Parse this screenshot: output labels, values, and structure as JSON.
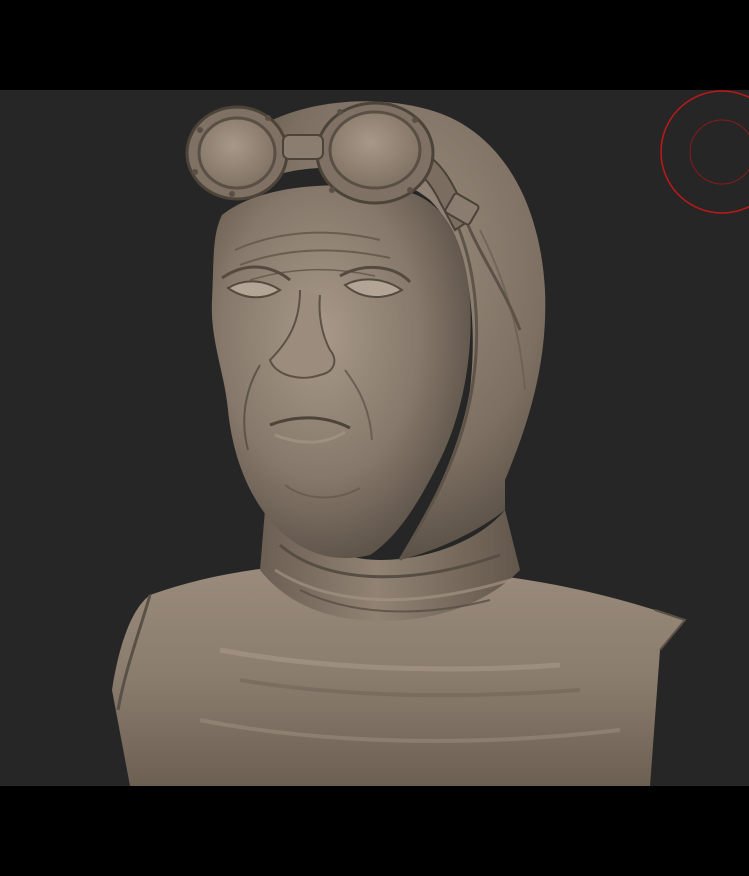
{
  "viewport": {
    "background_color": "#262626",
    "letterbox_color": "#000000",
    "model": {
      "icon": "sculpted-bust-aviator-with-goggles",
      "material_color": "#8a7a6a"
    },
    "brush_cursor": {
      "icon": "brush-cursor-circles",
      "color": "#c01818"
    }
  }
}
